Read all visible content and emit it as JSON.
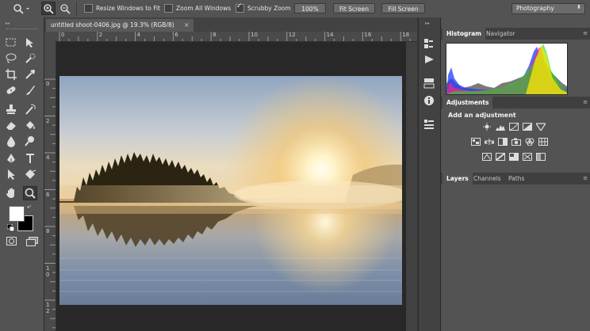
{
  "options_bar": {
    "resize_windows_label": "Resize Windows to Fit",
    "resize_windows_checked": false,
    "zoom_all_label": "Zoom All Windows",
    "zoom_all_checked": false,
    "scrubby_zoom_label": "Scrubby Zoom",
    "scrubby_zoom_checked": true,
    "btn_100": "100%",
    "btn_fit": "Fit Screen",
    "btn_fill": "Fill Screen",
    "workspace": "Photography"
  },
  "document": {
    "tab_title": "untitled shoot-0406.jpg @ 19.3% (RGB/8)",
    "close_glyph": "×"
  },
  "rulers": {
    "horizontal": [
      "0",
      "2",
      "4",
      "6",
      "8",
      "10",
      "12",
      "14",
      "16",
      "18"
    ],
    "vertical": [
      "0",
      "2",
      "4",
      "6",
      "8",
      "1 0",
      "1 2"
    ]
  },
  "panels": {
    "histogram_tabs": [
      "Histogram",
      "Navigator"
    ],
    "adjustments_tab": "Adjustments",
    "adjustments_heading": "Add an adjustment",
    "layers_tabs": [
      "Layers",
      "Channels",
      "Paths"
    ]
  },
  "colors": {
    "foreground": "#ffffff",
    "background": "#000000",
    "ui_panel": "#535353",
    "canvas_bg": "#282828"
  },
  "tools": [
    "marquee-icon",
    "move-icon",
    "lasso-icon",
    "quick-select-icon",
    "crop-icon",
    "eyedropper-icon",
    "healing-icon",
    "brush-icon",
    "clone-stamp-icon",
    "history-brush-icon",
    "eraser-icon",
    "paint-bucket-icon",
    "blur-icon",
    "dodge-icon",
    "pen-icon",
    "type-icon",
    "path-select-icon",
    "shape-icon",
    "hand-icon",
    "zoom-icon"
  ]
}
